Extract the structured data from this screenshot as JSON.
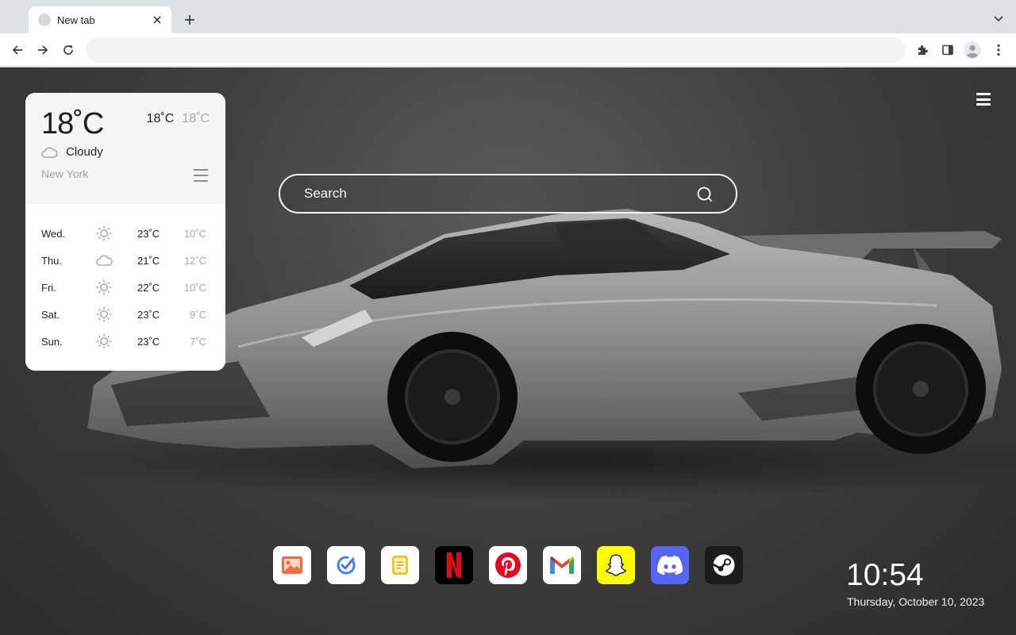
{
  "browser": {
    "tab": {
      "title": "New tab"
    },
    "omnibox": {
      "value": "",
      "placeholder": ""
    }
  },
  "colors": {
    "page_bg": "#3f3f41",
    "car_body": "#8c8c8e",
    "search_border": "#f2f2f2"
  },
  "search": {
    "placeholder": "Search"
  },
  "weather": {
    "temp": "18˚C",
    "high": "18˚C",
    "low": "18˚C",
    "condition": "Cloudy",
    "city": "New York",
    "forecast": [
      {
        "day": "Wed.",
        "icon": "sun-icon",
        "high": "23˚C",
        "low": "10˚C"
      },
      {
        "day": "Thu.",
        "icon": "cloud-icon",
        "high": "21˚C",
        "low": "12˚C"
      },
      {
        "day": "Fri.",
        "icon": "sun-icon",
        "high": "22˚C",
        "low": "10˚C"
      },
      {
        "day": "Sat.",
        "icon": "sun-icon",
        "high": "23˚C",
        "low": "9˚C"
      },
      {
        "day": "Sun.",
        "icon": "sun-icon",
        "high": "23˚C",
        "low": "7˚C"
      }
    ]
  },
  "dock": [
    {
      "name": "photos",
      "icon": "image-icon",
      "bg": "#ffffff"
    },
    {
      "name": "tasks",
      "icon": "check-icon",
      "bg": "#ffffff"
    },
    {
      "name": "notes",
      "icon": "note-icon",
      "bg": "#ffffff"
    },
    {
      "name": "netflix",
      "icon": "netflix-icon",
      "bg": "#000000"
    },
    {
      "name": "pinterest",
      "icon": "pinterest-icon",
      "bg": "#ffffff"
    },
    {
      "name": "gmail",
      "icon": "gmail-icon",
      "bg": "#ffffff"
    },
    {
      "name": "snapchat",
      "icon": "snapchat-icon",
      "bg": "#fffc00"
    },
    {
      "name": "discord",
      "icon": "discord-icon",
      "bg": "#5865f2"
    },
    {
      "name": "steam",
      "icon": "steam-icon",
      "bg": "#1b1b1b"
    }
  ],
  "clock": {
    "time": "10:54",
    "date": "Thursday, October 10, 2023"
  }
}
